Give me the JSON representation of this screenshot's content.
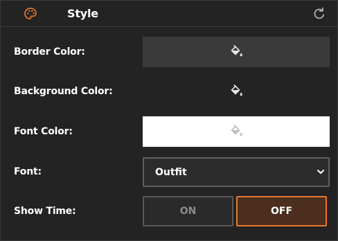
{
  "header": {
    "title": "Style",
    "icon": "palette-icon",
    "action_icon": "refresh-icon"
  },
  "rows": {
    "border_color": {
      "label": "Border Color:",
      "value_color": "#3a3a3a",
      "icon": "paint-bucket-icon"
    },
    "background_color": {
      "label": "Background Color:",
      "value_color": "#222222",
      "icon": "paint-bucket-icon"
    },
    "font_color": {
      "label": "Font Color:",
      "value_color": "#ffffff",
      "icon": "paint-bucket-icon"
    },
    "font": {
      "label": "Font:",
      "value": "Outfit"
    },
    "show_time": {
      "label": "Show Time:",
      "options": [
        "ON",
        "OFF"
      ],
      "selected": "OFF"
    }
  },
  "colors": {
    "accent": "#e8782f",
    "panel_bg": "#232323",
    "selected_bg": "#4b2e1e"
  }
}
